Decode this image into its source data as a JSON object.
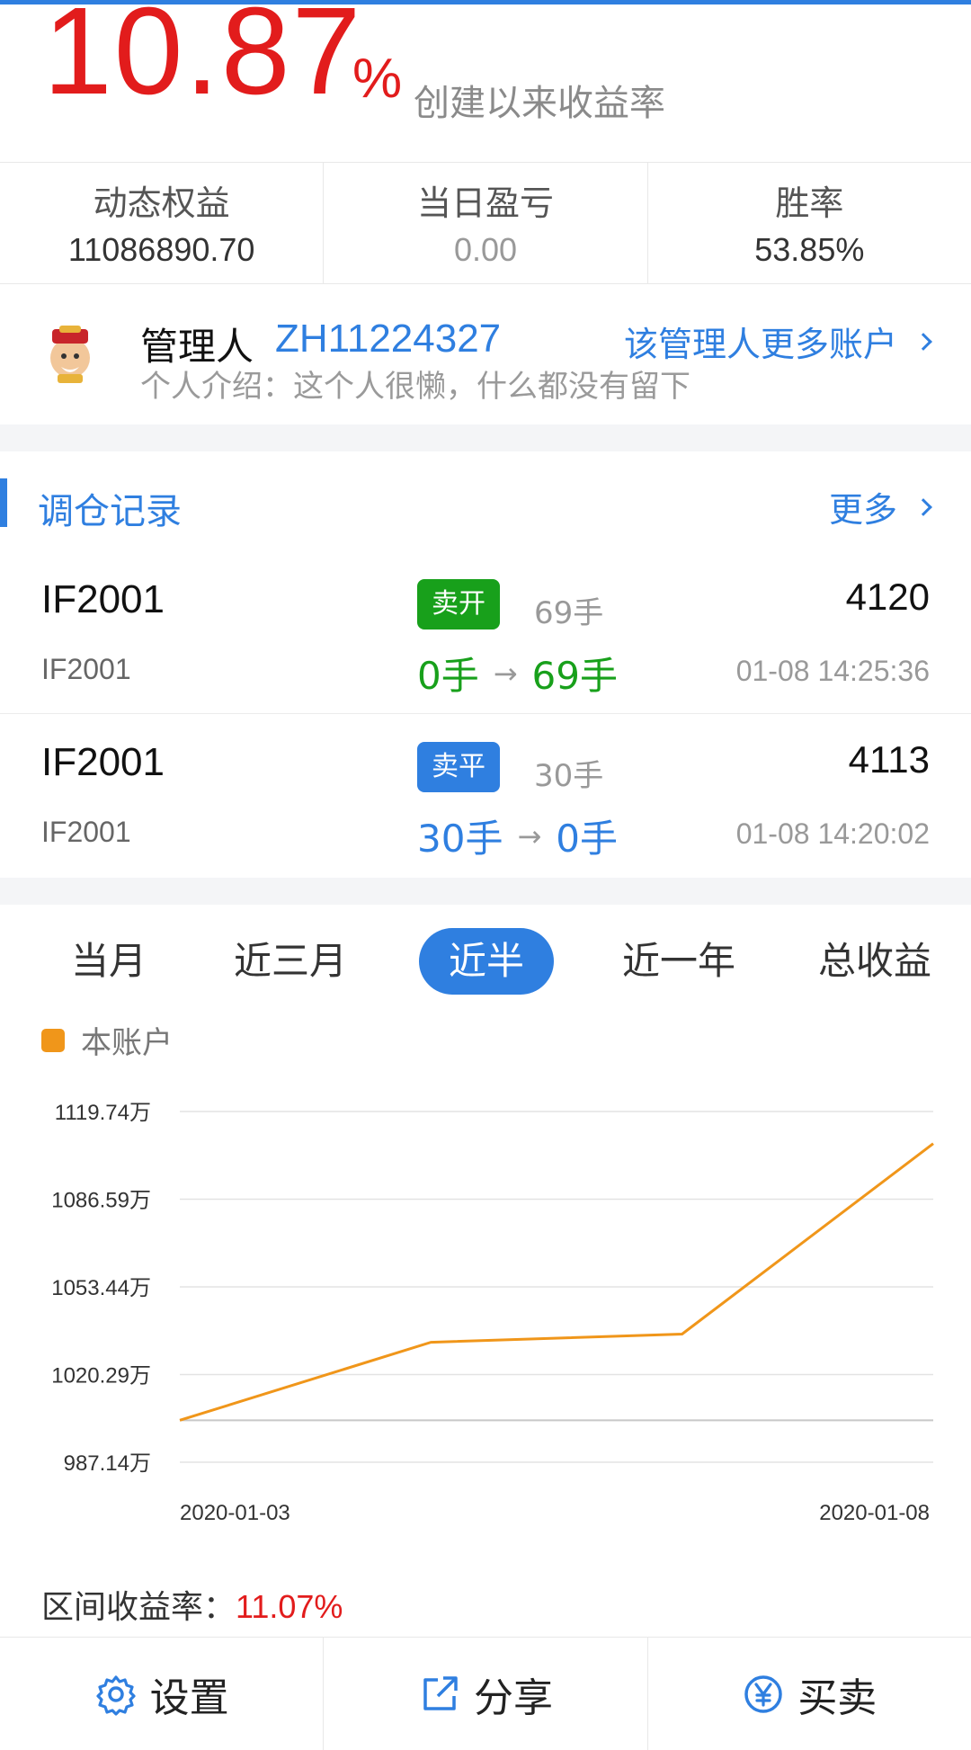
{
  "colors": {
    "accent": "#2f7fe0",
    "up": "#e21c1c",
    "green": "#18a01b",
    "line": "#f0961a"
  },
  "header": {
    "return_value": "10.87",
    "return_unit": "%",
    "return_label": "创建以来收益率"
  },
  "stats": [
    {
      "label": "动态权益",
      "value": "11086890.70"
    },
    {
      "label": "当日盈亏",
      "value": "0.00"
    },
    {
      "label": "胜率",
      "value": "53.85%"
    }
  ],
  "manager": {
    "label": "管理人",
    "id": "ZH11224327",
    "intro": "个人介绍：这个人很懒，什么都没有留下",
    "more": "该管理人更多账户"
  },
  "records": {
    "title": "调仓记录",
    "more": "更多",
    "items": [
      {
        "symbol": "IF2001",
        "symbol_sub": "IF2001",
        "action": "卖开",
        "qty": "69手",
        "price": "4120",
        "from": "0手",
        "to": "69手",
        "time": "01-08 14:25:36"
      },
      {
        "symbol": "IF2001",
        "symbol_sub": "IF2001",
        "action": "卖平",
        "qty": "30手",
        "price": "4113",
        "from": "30手",
        "to": "0手",
        "time": "01-08 14:20:02"
      }
    ]
  },
  "periods": [
    "当月",
    "近三月",
    "近半年",
    "近一年",
    "总收益"
  ],
  "active_period": "近半年",
  "legend": {
    "label": "本账户"
  },
  "chart_data": {
    "type": "line",
    "series": [
      {
        "name": "本账户",
        "values": [
          1003.0,
          1032.5,
          1035.6,
          1107.6
        ]
      }
    ],
    "x_start_label": "2020-01-03",
    "x_end_label": "2020-01-08",
    "y_ticks": [
      "1119.74万",
      "1086.59万",
      "1053.44万",
      "1020.29万",
      "987.14万"
    ],
    "ylim": [
      987.14,
      1119.74
    ],
    "unit": "万",
    "grid": true
  },
  "interval": {
    "label": "区间收益率：",
    "value": "11.07%"
  },
  "bottom": {
    "settings": "设置",
    "share": "分享",
    "trade": "买卖"
  }
}
